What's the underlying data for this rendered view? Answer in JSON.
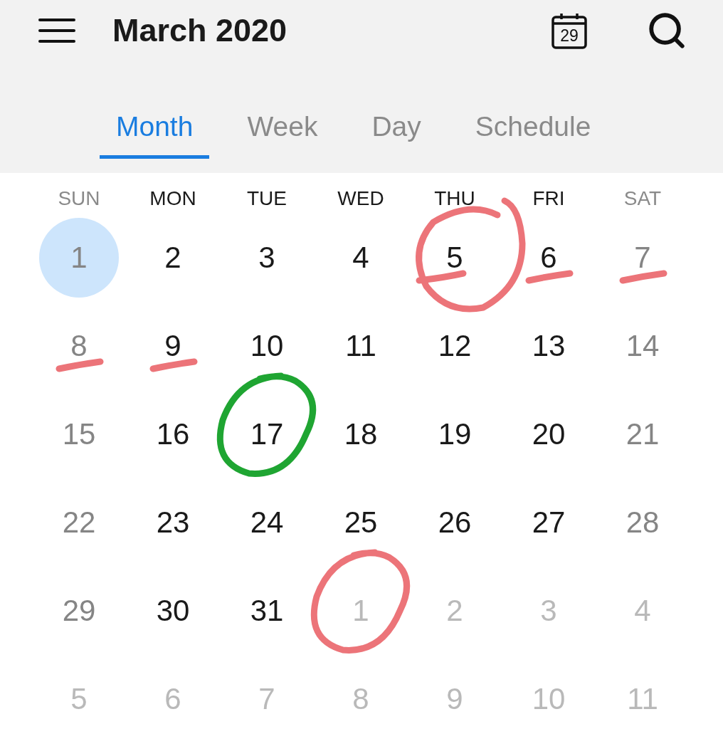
{
  "header": {
    "title": "March 2020",
    "today_icon_label": "29"
  },
  "tabs": [
    {
      "label": "Month",
      "selected": true
    },
    {
      "label": "Week",
      "selected": false
    },
    {
      "label": "Day",
      "selected": false
    },
    {
      "label": "Schedule",
      "selected": false
    }
  ],
  "weekdays": [
    {
      "label": "SUN",
      "weekend": true
    },
    {
      "label": "MON",
      "weekend": false
    },
    {
      "label": "TUE",
      "weekend": false
    },
    {
      "label": "WED",
      "weekend": false
    },
    {
      "label": "THU",
      "weekend": false
    },
    {
      "label": "FRI",
      "weekend": false
    },
    {
      "label": "SAT",
      "weekend": true
    }
  ],
  "weeks": [
    [
      {
        "label": "1",
        "other_month": false,
        "selected": true
      },
      {
        "label": "2",
        "other_month": false,
        "selected": false
      },
      {
        "label": "3",
        "other_month": false,
        "selected": false
      },
      {
        "label": "4",
        "other_month": false,
        "selected": false
      },
      {
        "label": "5",
        "other_month": false,
        "selected": false,
        "annotation": {
          "kind": "crossed-circle",
          "color": "#ec7479"
        }
      },
      {
        "label": "6",
        "other_month": false,
        "selected": false,
        "annotation": {
          "kind": "dash",
          "color": "#ec7479"
        }
      },
      {
        "label": "7",
        "other_month": false,
        "selected": false,
        "annotation": {
          "kind": "dash",
          "color": "#ec7479"
        }
      }
    ],
    [
      {
        "label": "8",
        "other_month": false,
        "selected": false,
        "annotation": {
          "kind": "dash",
          "color": "#ec7479"
        }
      },
      {
        "label": "9",
        "other_month": false,
        "selected": false,
        "annotation": {
          "kind": "dash",
          "color": "#ec7479"
        }
      },
      {
        "label": "10",
        "other_month": false,
        "selected": false
      },
      {
        "label": "11",
        "other_month": false,
        "selected": false
      },
      {
        "label": "12",
        "other_month": false,
        "selected": false
      },
      {
        "label": "13",
        "other_month": false,
        "selected": false
      },
      {
        "label": "14",
        "other_month": false,
        "selected": false
      }
    ],
    [
      {
        "label": "15",
        "other_month": false,
        "selected": false
      },
      {
        "label": "16",
        "other_month": false,
        "selected": false
      },
      {
        "label": "17",
        "other_month": false,
        "selected": false,
        "annotation": {
          "kind": "circle",
          "color": "#1fa532"
        }
      },
      {
        "label": "18",
        "other_month": false,
        "selected": false
      },
      {
        "label": "19",
        "other_month": false,
        "selected": false
      },
      {
        "label": "20",
        "other_month": false,
        "selected": false
      },
      {
        "label": "21",
        "other_month": false,
        "selected": false
      }
    ],
    [
      {
        "label": "22",
        "other_month": false,
        "selected": false
      },
      {
        "label": "23",
        "other_month": false,
        "selected": false
      },
      {
        "label": "24",
        "other_month": false,
        "selected": false
      },
      {
        "label": "25",
        "other_month": false,
        "selected": false
      },
      {
        "label": "26",
        "other_month": false,
        "selected": false
      },
      {
        "label": "27",
        "other_month": false,
        "selected": false
      },
      {
        "label": "28",
        "other_month": false,
        "selected": false
      }
    ],
    [
      {
        "label": "29",
        "other_month": false,
        "selected": false
      },
      {
        "label": "30",
        "other_month": false,
        "selected": false
      },
      {
        "label": "31",
        "other_month": false,
        "selected": false
      },
      {
        "label": "1",
        "other_month": true,
        "selected": false,
        "annotation": {
          "kind": "circle",
          "color": "#ec7479"
        }
      },
      {
        "label": "2",
        "other_month": true,
        "selected": false
      },
      {
        "label": "3",
        "other_month": true,
        "selected": false
      },
      {
        "label": "4",
        "other_month": true,
        "selected": false
      }
    ],
    [
      {
        "label": "5",
        "other_month": true,
        "selected": false
      },
      {
        "label": "6",
        "other_month": true,
        "selected": false
      },
      {
        "label": "7",
        "other_month": true,
        "selected": false
      },
      {
        "label": "8",
        "other_month": true,
        "selected": false
      },
      {
        "label": "9",
        "other_month": true,
        "selected": false
      },
      {
        "label": "10",
        "other_month": true,
        "selected": false
      },
      {
        "label": "11",
        "other_month": true,
        "selected": false
      }
    ]
  ]
}
